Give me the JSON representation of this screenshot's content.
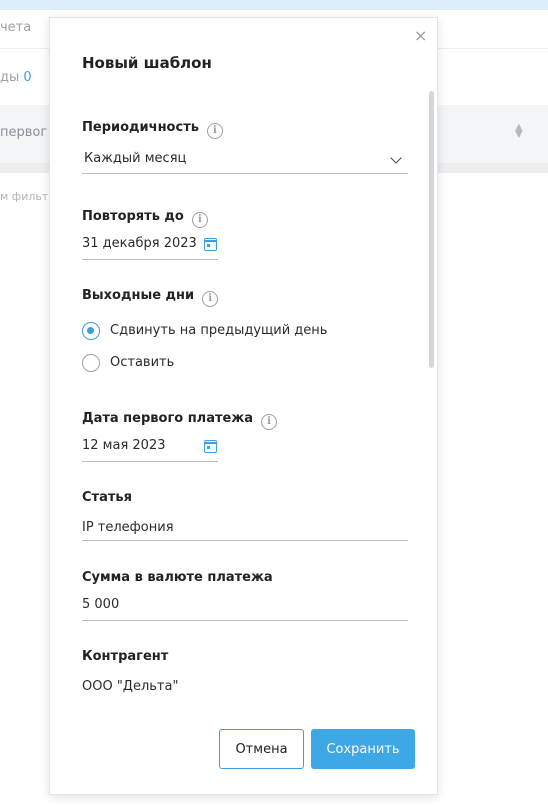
{
  "background": {
    "text1": "чета",
    "text2_prefix": "ды",
    "text2_count": "0",
    "header_text": "первог",
    "filter_text": "м фильтр"
  },
  "modal": {
    "title": "Новый шаблон",
    "close_label": "×",
    "periodicity": {
      "label": "Периодичность",
      "value": "Каждый месяц"
    },
    "repeat_until": {
      "label": "Повторять до",
      "value": "31 декабря 2023"
    },
    "weekends": {
      "label": "Выходные дни",
      "options": [
        {
          "label": "Сдвинуть на предыдущий день",
          "checked": true
        },
        {
          "label": "Оставить",
          "checked": false
        }
      ]
    },
    "first_payment_date": {
      "label": "Дата первого платежа",
      "value": "12 мая 2023"
    },
    "article": {
      "label": "Статья",
      "value": "IP телефония"
    },
    "amount": {
      "label": "Сумма в валюте платежа",
      "value": "5 000"
    },
    "counterparty": {
      "label": "Контрагент",
      "value": "ООО \"Дельта\""
    },
    "buttons": {
      "cancel": "Отмена",
      "save": "Сохранить"
    }
  },
  "colors": {
    "accent": "#3ea7e6"
  }
}
